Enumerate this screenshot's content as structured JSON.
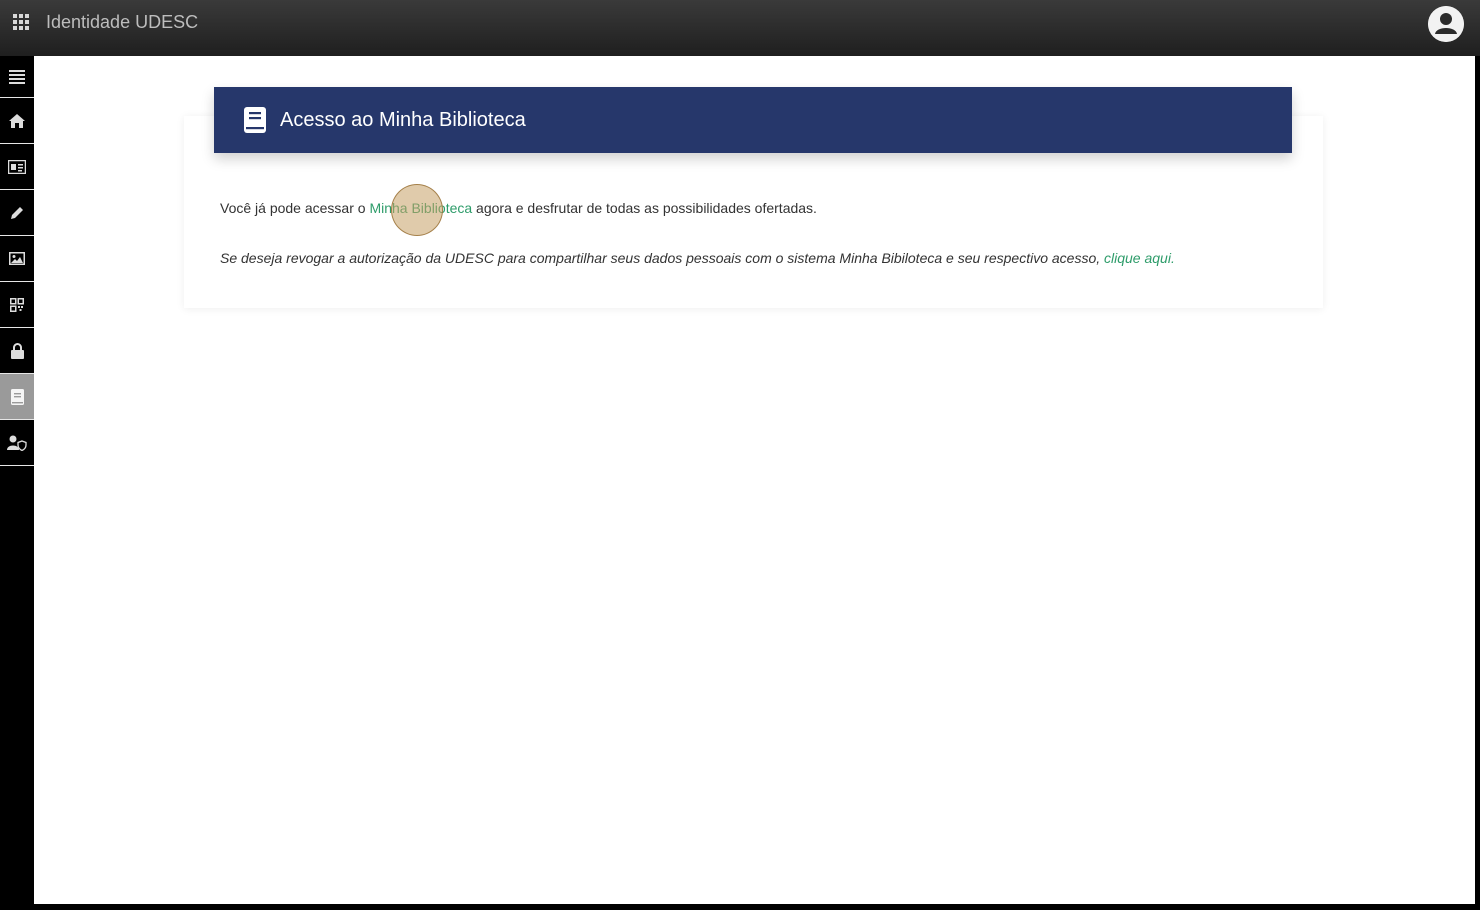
{
  "app": {
    "title": "Identidade UDESC"
  },
  "sidebar": {
    "items": [
      {
        "name": "menu",
        "icon": "list-icon",
        "active": false
      },
      {
        "name": "home",
        "icon": "home-icon",
        "active": false
      },
      {
        "name": "id-card",
        "icon": "id-card-icon",
        "active": false
      },
      {
        "name": "edit",
        "icon": "pencil-icon",
        "active": false
      },
      {
        "name": "photo",
        "icon": "image-icon",
        "active": false
      },
      {
        "name": "qr",
        "icon": "qr-code-icon",
        "active": false
      },
      {
        "name": "security",
        "icon": "lock-icon",
        "active": false
      },
      {
        "name": "library",
        "icon": "book-icon",
        "active": true
      },
      {
        "name": "privacy",
        "icon": "user-shield-icon",
        "active": false
      }
    ]
  },
  "card": {
    "title": "Acesso ao Minha Biblioteca",
    "line1": {
      "before": "Você já pode acessar o ",
      "link": "Minha Biblioteca",
      "after": " agora e desfrutar de todas as possibilidades ofertadas."
    },
    "line2": {
      "before": "Se deseja revogar a autorização da UDESC para compartilhar seus dados pessoais com o sistema Minha Bibiloteca e seu respectivo acesso, ",
      "link": "clique aqui."
    }
  },
  "colors": {
    "header_bg": "#26376b",
    "link": "#2e9c6a",
    "sidebar_active": "#9a9a9a"
  }
}
